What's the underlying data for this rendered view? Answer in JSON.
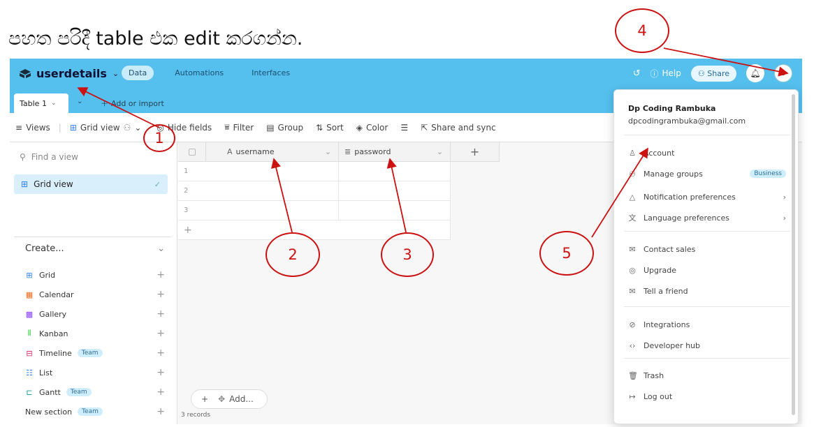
{
  "caption": "පහත පරිදී table එක edit කරගන්න.",
  "header": {
    "base_name": "userdetails",
    "nav_tabs": [
      "Data",
      "Automations",
      "Interfaces"
    ],
    "help_label": "Help",
    "share_label": "Share",
    "avatar_letter": "D"
  },
  "tabbar": {
    "table_tab": "Table 1",
    "add_import": "Add or import"
  },
  "toolbar": {
    "views": "Views",
    "grid_view": "Grid view",
    "hide_fields": "Hide fields",
    "filter": "Filter",
    "group": "Group",
    "sort": "Sort",
    "color": "Color",
    "share_sync": "Share and sync"
  },
  "sidebar": {
    "find_placeholder": "Find a view",
    "current_view": "Grid view",
    "create_label": "Create...",
    "create_items": [
      {
        "label": "Grid",
        "badge": "",
        "icon": "grid-icon",
        "color": "#2d7ff9"
      },
      {
        "label": "Calendar",
        "badge": "",
        "icon": "calendar-icon",
        "color": "#f06a1a"
      },
      {
        "label": "Gallery",
        "badge": "",
        "icon": "gallery-icon",
        "color": "#8b46ff"
      },
      {
        "label": "Kanban",
        "badge": "",
        "icon": "kanban-icon",
        "color": "#20c933"
      },
      {
        "label": "Timeline",
        "badge": "Team",
        "icon": "timeline-icon",
        "color": "#e01e5a"
      },
      {
        "label": "List",
        "badge": "",
        "icon": "list-icon",
        "color": "#2d7ff9"
      },
      {
        "label": "Gantt",
        "badge": "Team",
        "icon": "gantt-icon",
        "color": "#0f9d9a"
      },
      {
        "label": "New section",
        "badge": "Team",
        "icon": "",
        "color": "#333"
      }
    ]
  },
  "grid": {
    "columns": [
      "username",
      "password"
    ],
    "rows": [
      "1",
      "2",
      "3"
    ],
    "add_label": "Add...",
    "records": "3 records"
  },
  "menu": {
    "user_name": "Dp Coding Rambuka",
    "user_email": "dpcodingrambuka@gmail.com",
    "items": [
      {
        "label": "Account",
        "icon": "user-icon",
        "badge": "",
        "arrow": false
      },
      {
        "label": "Manage groups",
        "icon": "group-icon",
        "badge": "Business",
        "arrow": false
      },
      {
        "label": "Notification preferences",
        "icon": "bell-icon",
        "badge": "",
        "arrow": true
      },
      {
        "label": "Language preferences",
        "icon": "language-icon",
        "badge": "",
        "arrow": true
      },
      {
        "label": "Contact sales",
        "icon": "mail-icon",
        "badge": "",
        "arrow": false
      },
      {
        "label": "Upgrade",
        "icon": "upgrade-icon",
        "badge": "",
        "arrow": false
      },
      {
        "label": "Tell a friend",
        "icon": "mail-icon",
        "badge": "",
        "arrow": false
      },
      {
        "label": "Integrations",
        "icon": "link-icon",
        "badge": "",
        "arrow": false
      },
      {
        "label": "Developer hub",
        "icon": "code-icon",
        "badge": "",
        "arrow": false
      },
      {
        "label": "Trash",
        "icon": "trash-icon",
        "badge": "",
        "arrow": false
      },
      {
        "label": "Log out",
        "icon": "logout-icon",
        "badge": "",
        "arrow": false
      }
    ]
  },
  "annotations": [
    "1",
    "2",
    "3",
    "4",
    "5"
  ],
  "colors": {
    "accent": "#55bfee",
    "annotation": "#cc1111"
  }
}
